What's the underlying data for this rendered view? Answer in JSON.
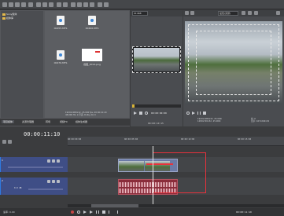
{
  "toolbar": {
    "preview_quality": "01468"
  },
  "explorer": {
    "tree": [
      "Sony媒体",
      "媒体库"
    ],
    "files": [
      "00455.MTS",
      "00466.MTS",
      "00476.MTS",
      "截图_2014.png"
    ],
    "tabs": [
      "项目媒体",
      "资源管理器",
      "转场",
      "视频FX",
      "媒体生成器"
    ],
    "info_lines": [
      "1920x1080x12, 25.000 fps, 00:00:10:20",
      "48,000 Hz, 2 声道, Dolby AC-3"
    ]
  },
  "trimmer": {
    "timecode": "00:00:00:00",
    "timecode_end": "00:00:10:15"
  },
  "preview": {
    "title": "最佳(完整)",
    "info_lines": [
      "1920x1080x32, 25.000i",
      "1280x720x32, 25.000i"
    ],
    "frame_label": "帧: 0",
    "display_label": "显示: 427x240x32"
  },
  "timeline": {
    "timecode": "00:00:11:10",
    "ruler": [
      "00:00:00:00",
      "00:00:05:00",
      "00:00:10:00",
      "00:00:15:00",
      "00:00:20:00"
    ],
    "tracks": [
      {
        "number": "1",
        "kind": "video"
      },
      {
        "number": "2",
        "kind": "audio",
        "volume": "0.0 dB"
      }
    ]
  },
  "transport": {
    "rate_label": "速率: 0.00",
    "position": "00:00:11:10"
  },
  "colors": {
    "accent": "#2f7ae0",
    "highlight_red": "#e8323c",
    "selection": "#3f4e86"
  }
}
